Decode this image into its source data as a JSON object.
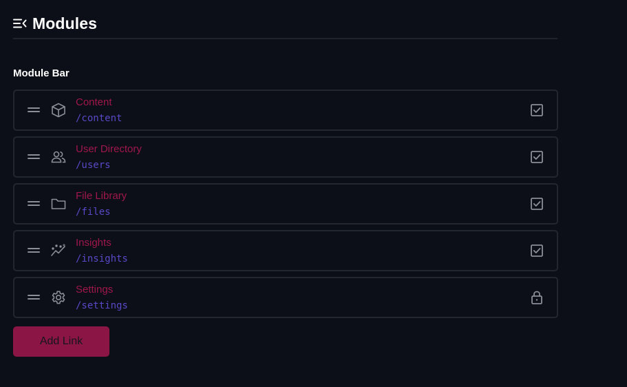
{
  "header": {
    "title": "Modules",
    "icon": "menu-collapse-icon"
  },
  "section": {
    "label": "Module Bar"
  },
  "modules": [
    {
      "title": "Content",
      "path": "/content",
      "icon": "cube-icon",
      "state": "checked"
    },
    {
      "title": "User Directory",
      "path": "/users",
      "icon": "users-icon",
      "state": "checked"
    },
    {
      "title": "File Library",
      "path": "/files",
      "icon": "folder-icon",
      "state": "checked"
    },
    {
      "title": "Insights",
      "path": "/insights",
      "icon": "insights-icon",
      "state": "checked"
    },
    {
      "title": "Settings",
      "path": "/settings",
      "icon": "gear-icon",
      "state": "locked"
    }
  ],
  "actions": {
    "add_link_label": "Add Link"
  },
  "colors": {
    "background": "#0c0f17",
    "title_accent": "#a0174d",
    "path_accent": "#5b48c8",
    "button": "#8b1544",
    "border": "#22262f",
    "icon": "#8b8f98"
  }
}
